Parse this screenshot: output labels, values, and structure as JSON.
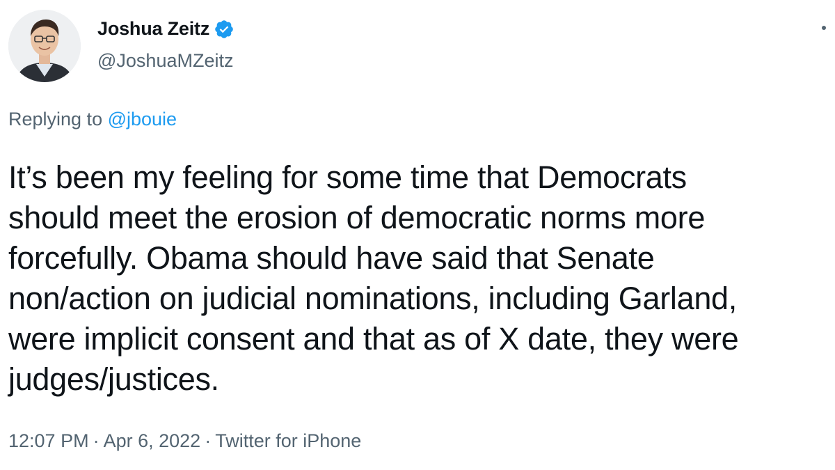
{
  "author": {
    "display_name": "Joshua Zeitz",
    "handle": "@JoshuaMZeitz",
    "verified_icon": "verified-badge-icon",
    "avatar_icon": "profile-avatar"
  },
  "reply": {
    "prefix": "Replying to ",
    "mention": "@jbouie"
  },
  "body": {
    "lines": [
      "It’s been my feeling for some time that Democrats",
      "should meet the erosion of democratic norms more",
      "forcefully. Obama should have said that Senate",
      "non/action on judicial nominations, including Garland,",
      "were implicit consent and that as of X date, they were",
      "judges/justices."
    ]
  },
  "meta": {
    "time": "12:07 PM",
    "separator": "·",
    "date": "Apr 6, 2022",
    "source": "Twitter for iPhone"
  },
  "colors": {
    "accent": "#1d9bf0",
    "text_primary": "#0f1419",
    "text_secondary": "#536471"
  }
}
